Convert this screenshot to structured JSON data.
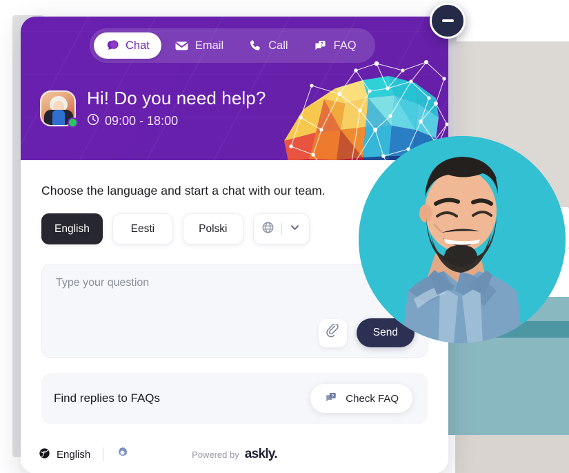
{
  "widget": {
    "minimize_label": "minimize",
    "tabs": [
      {
        "label": "Chat",
        "icon": "chat-bubble-icon",
        "active": true
      },
      {
        "label": "Email",
        "icon": "envelope-icon",
        "active": false
      },
      {
        "label": "Call",
        "icon": "phone-icon",
        "active": false
      },
      {
        "label": "FAQ",
        "icon": "faq-cards-icon",
        "active": false
      }
    ],
    "header": {
      "greeting": "Hi! Do you need help?",
      "hours": "09:00 - 18:00",
      "clock_icon": "clock-icon",
      "avatar_alt": "support-agent-avatar",
      "status": "online",
      "illustration": "low-poly-brain-network"
    },
    "body": {
      "prompt": "Choose the language and start a chat with our team.",
      "languages": [
        {
          "label": "English",
          "active": true
        },
        {
          "label": "Eesti",
          "active": false
        },
        {
          "label": "Polski",
          "active": false
        }
      ],
      "more_languages": {
        "globe_icon": "globe-icon",
        "chevron": "chevron-down-icon"
      },
      "composer": {
        "placeholder": "Type your question",
        "value": "",
        "attach_icon": "paperclip-icon",
        "send_label": "Send"
      },
      "faq": {
        "text": "Find replies to FAQs",
        "button_label": "Check FAQ",
        "button_icon": "faq-cards-icon"
      }
    },
    "footer": {
      "language": "English",
      "globe_icon": "globe-icon",
      "settings_icon": "gear-icon",
      "powered_by": "Powered by",
      "brand": "askly."
    }
  },
  "colors": {
    "header_purple": "#7d2cbd",
    "accent_dark": "#26272f",
    "send_navy": "#2c3154",
    "online_green": "#25c760",
    "panel_grey": "#f5f7fa",
    "teal": "#33c0d2",
    "beige": "#dcd8d3"
  }
}
